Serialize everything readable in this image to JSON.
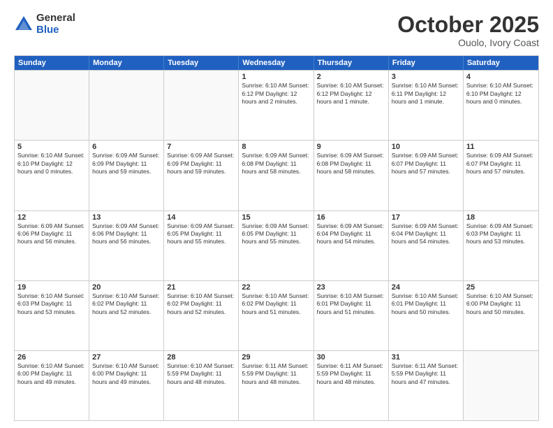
{
  "header": {
    "logo_general": "General",
    "logo_blue": "Blue",
    "month": "October 2025",
    "location": "Ouolo, Ivory Coast"
  },
  "days_of_week": [
    "Sunday",
    "Monday",
    "Tuesday",
    "Wednesday",
    "Thursday",
    "Friday",
    "Saturday"
  ],
  "weeks": [
    [
      {
        "day": "",
        "info": ""
      },
      {
        "day": "",
        "info": ""
      },
      {
        "day": "",
        "info": ""
      },
      {
        "day": "1",
        "info": "Sunrise: 6:10 AM\nSunset: 6:12 PM\nDaylight: 12 hours\nand 2 minutes."
      },
      {
        "day": "2",
        "info": "Sunrise: 6:10 AM\nSunset: 6:12 PM\nDaylight: 12 hours\nand 1 minute."
      },
      {
        "day": "3",
        "info": "Sunrise: 6:10 AM\nSunset: 6:11 PM\nDaylight: 12 hours\nand 1 minute."
      },
      {
        "day": "4",
        "info": "Sunrise: 6:10 AM\nSunset: 6:10 PM\nDaylight: 12 hours\nand 0 minutes."
      }
    ],
    [
      {
        "day": "5",
        "info": "Sunrise: 6:10 AM\nSunset: 6:10 PM\nDaylight: 12 hours\nand 0 minutes."
      },
      {
        "day": "6",
        "info": "Sunrise: 6:09 AM\nSunset: 6:09 PM\nDaylight: 11 hours\nand 59 minutes."
      },
      {
        "day": "7",
        "info": "Sunrise: 6:09 AM\nSunset: 6:09 PM\nDaylight: 11 hours\nand 59 minutes."
      },
      {
        "day": "8",
        "info": "Sunrise: 6:09 AM\nSunset: 6:08 PM\nDaylight: 11 hours\nand 58 minutes."
      },
      {
        "day": "9",
        "info": "Sunrise: 6:09 AM\nSunset: 6:08 PM\nDaylight: 11 hours\nand 58 minutes."
      },
      {
        "day": "10",
        "info": "Sunrise: 6:09 AM\nSunset: 6:07 PM\nDaylight: 11 hours\nand 57 minutes."
      },
      {
        "day": "11",
        "info": "Sunrise: 6:09 AM\nSunset: 6:07 PM\nDaylight: 11 hours\nand 57 minutes."
      }
    ],
    [
      {
        "day": "12",
        "info": "Sunrise: 6:09 AM\nSunset: 6:06 PM\nDaylight: 11 hours\nand 56 minutes."
      },
      {
        "day": "13",
        "info": "Sunrise: 6:09 AM\nSunset: 6:06 PM\nDaylight: 11 hours\nand 56 minutes."
      },
      {
        "day": "14",
        "info": "Sunrise: 6:09 AM\nSunset: 6:05 PM\nDaylight: 11 hours\nand 55 minutes."
      },
      {
        "day": "15",
        "info": "Sunrise: 6:09 AM\nSunset: 6:05 PM\nDaylight: 11 hours\nand 55 minutes."
      },
      {
        "day": "16",
        "info": "Sunrise: 6:09 AM\nSunset: 6:04 PM\nDaylight: 11 hours\nand 54 minutes."
      },
      {
        "day": "17",
        "info": "Sunrise: 6:09 AM\nSunset: 6:04 PM\nDaylight: 11 hours\nand 54 minutes."
      },
      {
        "day": "18",
        "info": "Sunrise: 6:09 AM\nSunset: 6:03 PM\nDaylight: 11 hours\nand 53 minutes."
      }
    ],
    [
      {
        "day": "19",
        "info": "Sunrise: 6:10 AM\nSunset: 6:03 PM\nDaylight: 11 hours\nand 53 minutes."
      },
      {
        "day": "20",
        "info": "Sunrise: 6:10 AM\nSunset: 6:02 PM\nDaylight: 11 hours\nand 52 minutes."
      },
      {
        "day": "21",
        "info": "Sunrise: 6:10 AM\nSunset: 6:02 PM\nDaylight: 11 hours\nand 52 minutes."
      },
      {
        "day": "22",
        "info": "Sunrise: 6:10 AM\nSunset: 6:02 PM\nDaylight: 11 hours\nand 51 minutes."
      },
      {
        "day": "23",
        "info": "Sunrise: 6:10 AM\nSunset: 6:01 PM\nDaylight: 11 hours\nand 51 minutes."
      },
      {
        "day": "24",
        "info": "Sunrise: 6:10 AM\nSunset: 6:01 PM\nDaylight: 11 hours\nand 50 minutes."
      },
      {
        "day": "25",
        "info": "Sunrise: 6:10 AM\nSunset: 6:00 PM\nDaylight: 11 hours\nand 50 minutes."
      }
    ],
    [
      {
        "day": "26",
        "info": "Sunrise: 6:10 AM\nSunset: 6:00 PM\nDaylight: 11 hours\nand 49 minutes."
      },
      {
        "day": "27",
        "info": "Sunrise: 6:10 AM\nSunset: 6:00 PM\nDaylight: 11 hours\nand 49 minutes."
      },
      {
        "day": "28",
        "info": "Sunrise: 6:10 AM\nSunset: 5:59 PM\nDaylight: 11 hours\nand 48 minutes."
      },
      {
        "day": "29",
        "info": "Sunrise: 6:11 AM\nSunset: 5:59 PM\nDaylight: 11 hours\nand 48 minutes."
      },
      {
        "day": "30",
        "info": "Sunrise: 6:11 AM\nSunset: 5:59 PM\nDaylight: 11 hours\nand 48 minutes."
      },
      {
        "day": "31",
        "info": "Sunrise: 6:11 AM\nSunset: 5:59 PM\nDaylight: 11 hours\nand 47 minutes."
      },
      {
        "day": "",
        "info": ""
      }
    ]
  ]
}
